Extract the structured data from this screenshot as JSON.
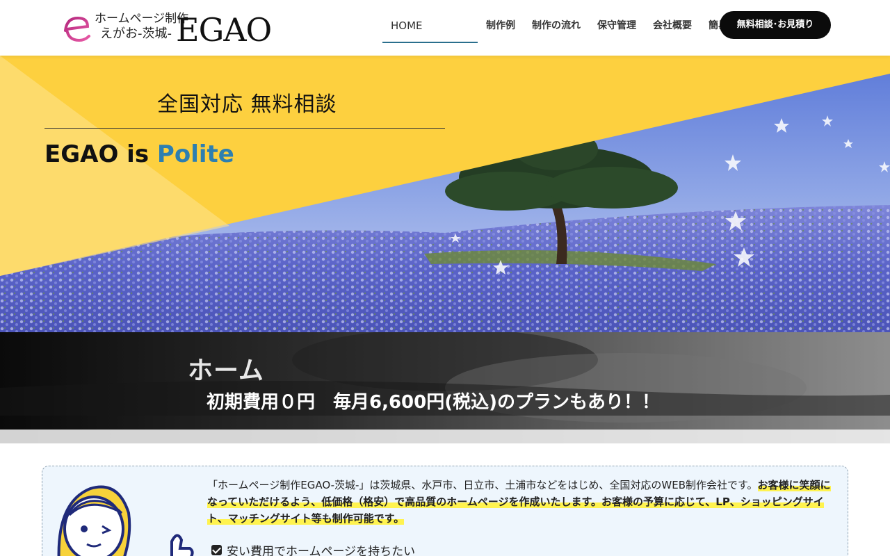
{
  "header": {
    "logo_line1": "ホームページ制作",
    "logo_line2": "えがお-茨城-",
    "logo_big": "EGAO",
    "nav": [
      "HOME",
      "制作例",
      "制作の流れ",
      "保守管理",
      "会社概要",
      "簡易見積り"
    ],
    "cta": "無料相談･お見積り"
  },
  "hero": {
    "tagline": "全国対応 無料相談",
    "title_prefix": "EGAO is ",
    "title_accent": "Polite"
  },
  "banner": {
    "title": "ホーム",
    "plan": "初期費用０円　毎月6,600円(税込)のプランもあり！！"
  },
  "intro": {
    "text_normal": "「ホームページ制作EGAO-茨城-」は茨城県、水戸市、日立市、土浦市などをはじめ、全国対応のWEB制作会社です。",
    "text_highlight": "お客様に笑顔になっていただけるよう、低価格（格安）で高品質のホームページを作成いたします。お客様の予算に応じて、LP、ショッピングサイト、マッチングサイト等も制作可能です。",
    "check_item": "安い費用でホームページを持ちたい"
  },
  "colors": {
    "accent_blue": "#2d7fb0",
    "hero_yellow": "#fdd03f",
    "cta_black": "#0b0b0b",
    "highlight": "#fff34f"
  }
}
